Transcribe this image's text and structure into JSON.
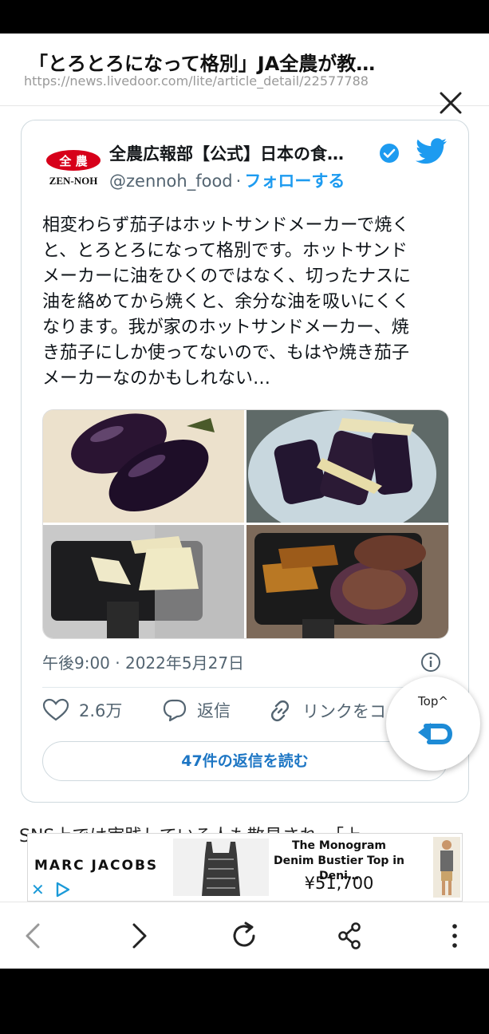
{
  "header": {
    "title": "「とろとろになって格別」JA全農が教…",
    "url": "https://news.livedoor.com/lite/article_detail/22577788"
  },
  "tweet": {
    "logo_text_top": "全 農",
    "logo_text_bottom": "ZEN-NOH",
    "author": "全農広報部【公式】日本の食…",
    "handle": "@zennoh_food",
    "separator": "·",
    "follow": "フォローする",
    "text": "相変わらず茄子はホットサンドメーカーで焼く\nと、とろとろになって格別です。ホットサンド\nメーカーに油をひくのではなく、切ったナスに\n油を絡めてから焼くと、余分な油を吸いにくく\nなります。我が家のホットサンドメーカー、焼\nき茄子にしか使ってないので、もはや焼き茄子\nメーカーなのかもしれない…",
    "timestamp": "午後9:00 · 2022年5月27日",
    "likes": "2.6万",
    "reply_label": "返信",
    "link_label": "リンクをコ",
    "read_replies": "47件の返信を読む"
  },
  "top_button": {
    "label": "Top^"
  },
  "article_text": "SNS上では実践している人も散見され、「上",
  "ad": {
    "brand": "MARC JACOBS",
    "product": "The Monogram Denim Bustier Top in Deni…",
    "price": "¥51,700"
  },
  "colors": {
    "twitter_blue": "#1d9bf0",
    "link_blue": "#1d76c4",
    "zennoh_red": "#d7001a"
  },
  "icons": [
    "close-icon",
    "verified-icon",
    "twitter-bird-icon",
    "info-icon",
    "heart-icon",
    "reply-bubble-icon",
    "link-icon",
    "return-arrow-icon",
    "back-icon",
    "forward-icon",
    "reload-icon",
    "share-icon",
    "more-icon"
  ]
}
